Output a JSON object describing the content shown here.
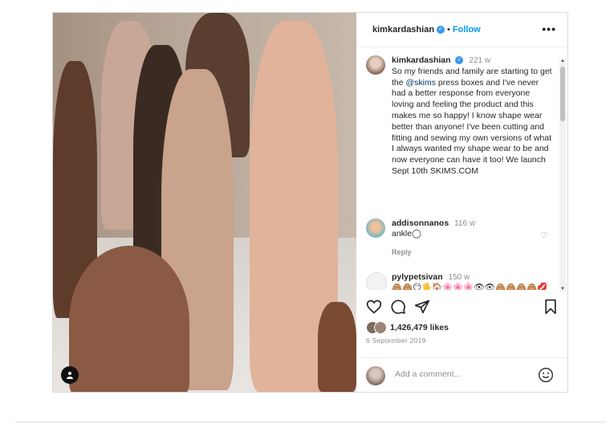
{
  "post": {
    "username": "kimkardashian",
    "separator": "•",
    "follow_label": "Follow",
    "more_label": "•••"
  },
  "caption": {
    "username": "kimkardashian",
    "time": "221 w",
    "text_before": "So my friends and family are starting to get the ",
    "mention": "@skims",
    "text_after": " press boxes and I've never had a better response from everyone loving and feeling the product and this makes me so happy! I know shape wear better than anyone! I've been cutting and fitting and sewing my own versions of what I always wanted my shape wear to be and now everyone can have it too! We launch Sept 10th SKIMS.COM"
  },
  "comments": [
    {
      "username": "addisonnanos",
      "time": "116 w",
      "text": "ankle◯",
      "reply_label": "Reply"
    },
    {
      "username": "pylypetsivan",
      "time": "150 w",
      "text": "🙈🙈😶🖐🏠🌸🌸🌸👁👁🙈🙈🙈🙈💋"
    }
  ],
  "likes": {
    "count_text": "1,426,479 likes"
  },
  "date": "6 September 2019",
  "add_comment": {
    "placeholder": "Add a comment..."
  },
  "colors": {
    "link": "#0095f6",
    "verified": "#3897f0",
    "muted": "#8e8e8e"
  },
  "icons": [
    "user-tag-icon",
    "verified-icon",
    "more-icon",
    "heart-icon",
    "comment-icon",
    "share-icon",
    "bookmark-icon",
    "emoji-icon"
  ]
}
